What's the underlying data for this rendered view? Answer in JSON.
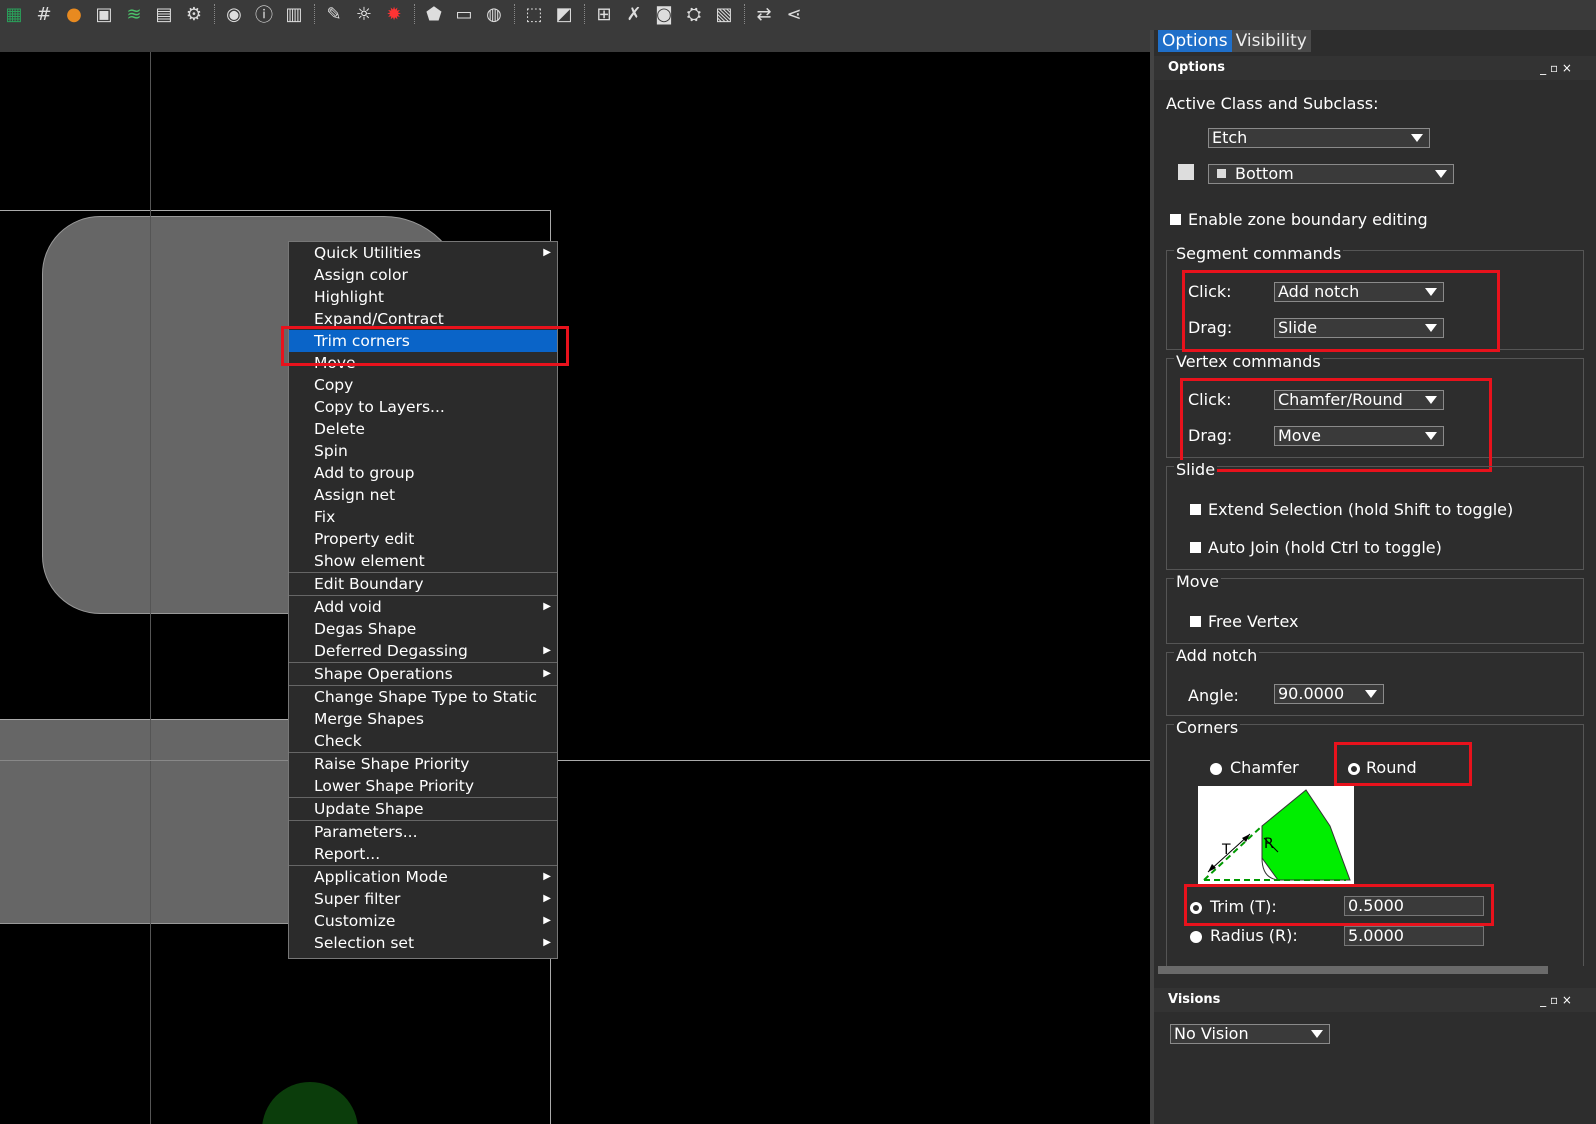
{
  "toolbar": {
    "icons": [
      "board-icon",
      "grid-icon",
      "color-wheel-icon",
      "shadow-icon",
      "layers-icon",
      "spreadsheet-icon",
      "settings-sheet-icon",
      "eye-icon",
      "info-icon",
      "3d-icon",
      "visibility-icon",
      "brightness-icon",
      "dim-icon",
      "add-shape-icon",
      "add-rect-icon",
      "add-circle-icon",
      "select-icon",
      "slash-shape-icon",
      "compose-icon",
      "fix-icon",
      "camera-icon",
      "r2-icon",
      "report-icon",
      "swap-icon",
      "share-icon"
    ]
  },
  "context_menu": {
    "items": [
      {
        "label": "Quick Utilities",
        "submenu": true
      },
      {
        "label": "Assign color",
        "submenu": false
      },
      {
        "label": "Highlight",
        "submenu": false
      },
      {
        "label": "Expand/Contract",
        "submenu": false
      },
      {
        "label": "Trim corners",
        "submenu": false,
        "active": true
      },
      {
        "label": "Move",
        "submenu": false
      },
      {
        "label": "Copy",
        "submenu": false
      },
      {
        "label": "Copy to Layers...",
        "submenu": false
      },
      {
        "label": "Delete",
        "submenu": false
      },
      {
        "label": "Spin",
        "submenu": false
      },
      {
        "label": "Add to group",
        "submenu": false
      },
      {
        "label": "Assign net",
        "submenu": false
      },
      {
        "label": "Fix",
        "submenu": false
      },
      {
        "label": "Property edit",
        "submenu": false
      },
      {
        "label": "Show element",
        "submenu": false
      },
      {
        "label": "Edit Boundary",
        "submenu": false
      },
      {
        "label": "Add void",
        "submenu": true
      },
      {
        "label": "Degas Shape",
        "submenu": false
      },
      {
        "label": "Deferred Degassing",
        "submenu": true
      },
      {
        "label": "Shape Operations",
        "submenu": true
      },
      {
        "label": "Change Shape Type to Static",
        "submenu": false
      },
      {
        "label": "Merge Shapes",
        "submenu": false
      },
      {
        "label": "Check",
        "submenu": false
      },
      {
        "label": "Raise Shape Priority",
        "submenu": false
      },
      {
        "label": "Lower Shape Priority",
        "submenu": false
      },
      {
        "label": "Update Shape",
        "submenu": false
      },
      {
        "label": "Parameters...",
        "submenu": false
      },
      {
        "label": "Report...",
        "submenu": false
      },
      {
        "label": "Application Mode",
        "submenu": true
      },
      {
        "label": "Super filter",
        "submenu": true
      },
      {
        "label": "Customize",
        "submenu": true
      },
      {
        "label": "Selection set",
        "submenu": true
      }
    ]
  },
  "panel": {
    "tabs": [
      "Options",
      "Visibility"
    ],
    "options_header": "Options",
    "active_class_label": "Active Class and Subclass:",
    "class_value": "Etch",
    "subclass_value": "Bottom",
    "enable_zone_label": "Enable zone boundary editing",
    "segment": {
      "title": "Segment commands",
      "click_label": "Click:",
      "click_value": "Add notch",
      "drag_label": "Drag:",
      "drag_value": "Slide"
    },
    "vertex": {
      "title": "Vertex commands",
      "click_label": "Click:",
      "click_value": "Chamfer/Round",
      "drag_label": "Drag:",
      "drag_value": "Move"
    },
    "slide": {
      "title": "Slide",
      "extend_label": "Extend Selection (hold Shift to toggle)",
      "autojoin_label": "Auto Join (hold Ctrl to toggle)"
    },
    "move": {
      "title": "Move",
      "free_vertex_label": "Free Vertex"
    },
    "add_notch": {
      "title": "Add notch",
      "angle_label": "Angle:",
      "angle_value": "90.0000"
    },
    "corners": {
      "title": "Corners",
      "chamfer_label": "Chamfer",
      "round_label": "Round",
      "selected": "Round",
      "diagram_t": "T",
      "diagram_r": "R",
      "trim_label": "Trim (T):",
      "trim_value": "0.5000",
      "radius_label": "Radius (R):",
      "radius_value": "5.0000"
    },
    "visions_header": "Visions",
    "vision_value": "No Vision",
    "win_controls": "_ ▫ ×"
  },
  "colors": {
    "accent": "#1f6fc9",
    "highlight_box": "#e8121c",
    "menu_active": "#0a64c8",
    "corner_fill": "#00ee00"
  }
}
